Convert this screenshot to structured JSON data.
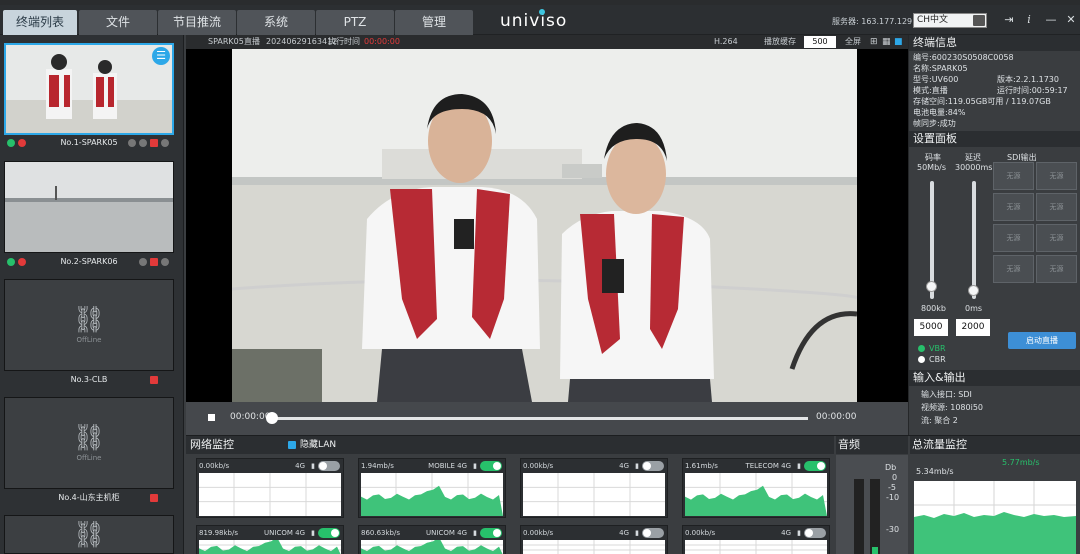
{
  "tabs": [
    {
      "label": "终端列表",
      "active": true
    },
    {
      "label": "文件",
      "active": false
    },
    {
      "label": "节目推流",
      "active": false
    },
    {
      "label": "系统",
      "active": false
    },
    {
      "label": "PTZ",
      "active": false
    },
    {
      "label": "管理",
      "active": false
    }
  ],
  "logo": "univiso",
  "header": {
    "server": "服务器: 163.177.129.46",
    "language": "CH中文"
  },
  "sidebar": {
    "devices": [
      {
        "name": "No.1-SPARK05",
        "status": "live"
      },
      {
        "name": "No.2-SPARK06",
        "status": "live"
      },
      {
        "name": "No.3-CLB",
        "status": "offline",
        "offline_label": "OffLine"
      },
      {
        "name": "No.4-山东主机柜",
        "status": "offline",
        "offline_label": "OffLine"
      }
    ]
  },
  "video_header": {
    "device": "SPARK05",
    "mode": "直播",
    "timestamp": "20240629163412",
    "running": "执行时间",
    "rec": "00:00:00",
    "codec": "H.264",
    "buffer_label": "播放缓存",
    "buffer_value": "500",
    "fullscreen": "全屏"
  },
  "playbar": {
    "start": "00:00:00",
    "end": "00:00:00",
    "progress": 0.0
  },
  "terminal_info": {
    "title": "终端信息",
    "id_label": "编号:",
    "id": "600230S0508C0058",
    "name_label": "名称:",
    "name": "SPARK05",
    "model_label": "型号:",
    "model": "UV600",
    "version_label": "版本:",
    "version": "2.2.1.1730",
    "mode_label": "模式:",
    "mode": "直播",
    "runtime_label": "运行时间:",
    "runtime": "00:59:17",
    "storage_label": "存储空间:",
    "storage": "119.05GB可用 / 119.07GB",
    "battery_label": "电池电量:",
    "battery": "84%",
    "sync_label": "帧同步:",
    "sync": "成功"
  },
  "settings": {
    "title": "设置面板",
    "bitrate_label": "码率",
    "bitrate_max": "50Mb/s",
    "bitrate_min": "800kb",
    "bitrate_value": "5000",
    "bitrate_level": 0.1,
    "delay_label": "延迟",
    "delay_max": "30000ms",
    "delay_min": "0ms",
    "delay_value": "2000",
    "delay_level": 0.07,
    "sdi_label": "SDI输出",
    "sdi_cells": [
      "无源",
      "无源",
      "无源",
      "无源",
      "无源",
      "无源",
      "无源",
      "无源"
    ],
    "vbr": "VBR",
    "cbr": "CBR",
    "start_btn": "启动直播"
  },
  "io": {
    "title": "输入&输出",
    "input_label": "输入接口:",
    "input": "SDI",
    "format_label": "视频源:",
    "format": "1080i50",
    "stream_label": "流:",
    "stream": "聚合 2"
  },
  "network": {
    "title": "网络监控",
    "lan": "隐藏LAN",
    "cards": [
      {
        "rate": "0.00kb/s",
        "net": "4G",
        "on": false
      },
      {
        "rate": "1.94mb/s",
        "net": "MOBILE 4G",
        "on": true
      },
      {
        "rate": "0.00kb/s",
        "net": "4G",
        "on": false
      },
      {
        "rate": "1.61mb/s",
        "net": "TELECOM 4G",
        "on": true
      }
    ],
    "cards2": [
      {
        "rate": "819.98kb/s",
        "net": "UNICOM 4G",
        "on": true
      },
      {
        "rate": "860.63kb/s",
        "net": "UNICOM 4G",
        "on": true
      },
      {
        "rate": "0.00kb/s",
        "net": "4G",
        "on": false
      },
      {
        "rate": "0.00kb/s",
        "net": "4G",
        "on": false
      }
    ]
  },
  "audio": {
    "title": "音频",
    "db": "Db",
    "ticks": [
      "0",
      "-5",
      "-10",
      "-30"
    ]
  },
  "total": {
    "title": "总流量监控",
    "rate": "5.34mb/s",
    "peak": "5.77mb/s"
  },
  "colors": {
    "accent": "#2da8e8",
    "green": "#27c06b",
    "rec": "#e23a3a",
    "blue_btn": "#3d8fd6"
  }
}
